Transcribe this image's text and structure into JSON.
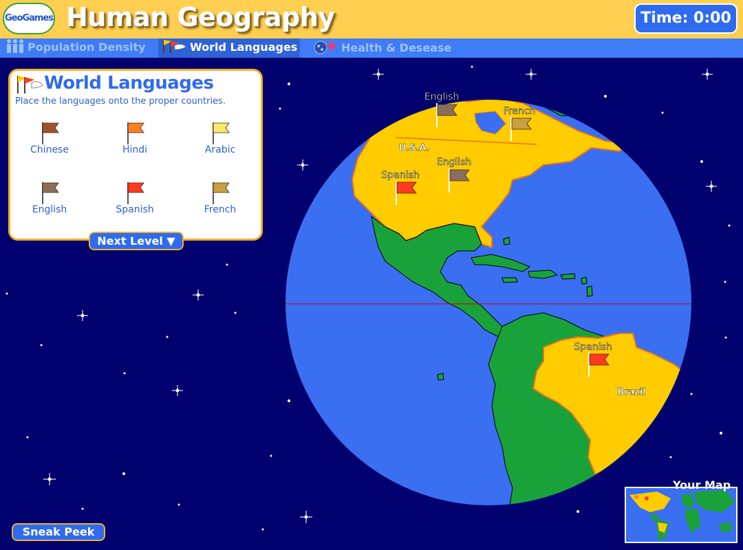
{
  "header": {
    "logo_text": "GeoGames",
    "title": "Human Geography",
    "timer": "Time: 0:00"
  },
  "nav": {
    "tabs": [
      {
        "label": "Population Density",
        "icon": "people-icon",
        "active": false
      },
      {
        "label": "World Languages",
        "icon": "flags-icon",
        "active": true
      },
      {
        "label": "Health & Desease",
        "icon": "germ-icon",
        "active": false
      }
    ]
  },
  "panel": {
    "title": "World Languages",
    "instructions": "Place the languages onto the proper countries.",
    "flags": [
      {
        "label": "Chinese",
        "color": "#a0522d"
      },
      {
        "label": "Hindi",
        "color": "#ff7f27"
      },
      {
        "label": "Arabic",
        "color": "#ffe866"
      },
      {
        "label": "English",
        "color": "#8b6e5a"
      },
      {
        "label": "Spanish",
        "color": "#ff3b1f"
      },
      {
        "label": "French",
        "color": "#c8a040"
      }
    ],
    "next_label": "Next Level"
  },
  "globe": {
    "country_labels": [
      "U.S.A.",
      "Brazil"
    ],
    "placed_flags": [
      {
        "label": "English",
        "color": "#8b6e5a"
      },
      {
        "label": "French",
        "color": "#c8a040"
      },
      {
        "label": "English",
        "color": "#8b6e5a"
      },
      {
        "label": "Spanish",
        "color": "#ff3b1f"
      },
      {
        "label": "Spanish",
        "color": "#ff3b1f"
      }
    ]
  },
  "footer": {
    "sneak_peek_label": "Sneak Peek",
    "your_map_label": "Your Map"
  },
  "colors": {
    "space": "#00006e",
    "ocean": "#3a6ff2",
    "land": "#1aa23a",
    "highlight": "#ffcc00",
    "accent": "#2f6bf0",
    "header": "#ffcf52"
  }
}
